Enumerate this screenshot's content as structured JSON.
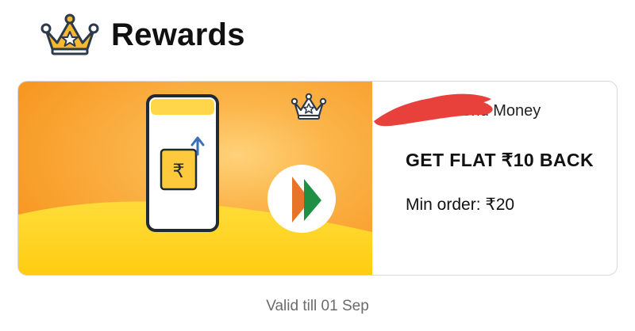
{
  "header": {
    "title": "Rewards",
    "icon": "crown-icon"
  },
  "reward_card": {
    "offer_type": "Send Money",
    "offer_title": "GET FLAT ₹10 BACK",
    "min_order": "Min order: ₹20",
    "icons": [
      "phone-send-money-icon",
      "crown-icon",
      "bhim-upi-logo-icon"
    ],
    "currency_symbol": "₹"
  },
  "footer": {
    "validity": "Valid till 01 Sep"
  },
  "colors": {
    "banner_orange": "#f7941d",
    "banner_yellow": "#ffd21a",
    "crown_outline": "#2d3a4a",
    "crown_gold": "#f5b931",
    "redaction": "#e8403a"
  }
}
